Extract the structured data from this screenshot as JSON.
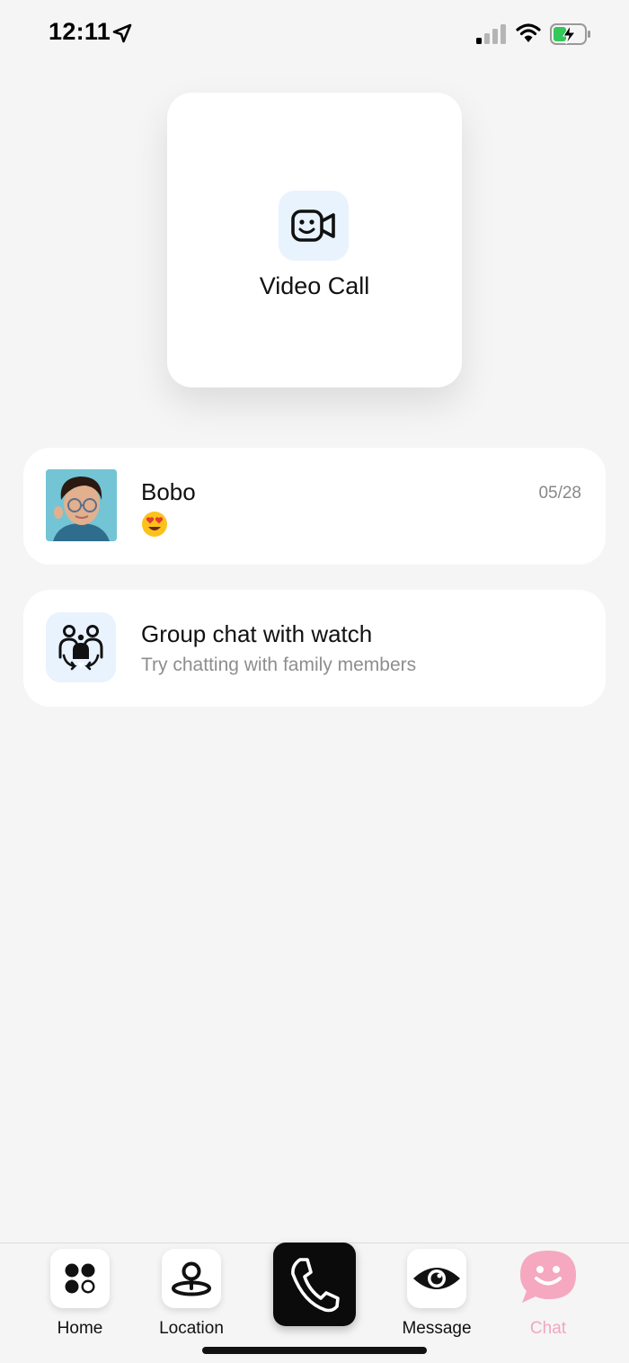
{
  "status_bar": {
    "time": "12:11",
    "icons": [
      "location-arrow-icon",
      "cellular-signal-icon",
      "wifi-icon",
      "battery-charging-icon"
    ]
  },
  "video_call": {
    "label": "Video Call",
    "icon": "video-camera-smile-icon",
    "icon_bg": "#e9f3fd"
  },
  "chats": [
    {
      "name": "Bobo",
      "last_message_icon": "heart-eyes-emoji",
      "date": "05/28"
    },
    {
      "name": "Group chat with watch",
      "subtitle": "Try chatting with family members",
      "icon": "family-group-icon"
    }
  ],
  "bottom_nav": {
    "items": [
      {
        "label": "Home",
        "icon": "home-dots-icon"
      },
      {
        "label": "Location",
        "icon": "location-pin-icon"
      },
      {
        "label": "",
        "icon": "phone-icon"
      },
      {
        "label": "Message",
        "icon": "eye-icon"
      },
      {
        "label": "Chat",
        "icon": "chat-smile-icon",
        "active": true
      }
    ],
    "active_color": "#f0a7bf"
  }
}
